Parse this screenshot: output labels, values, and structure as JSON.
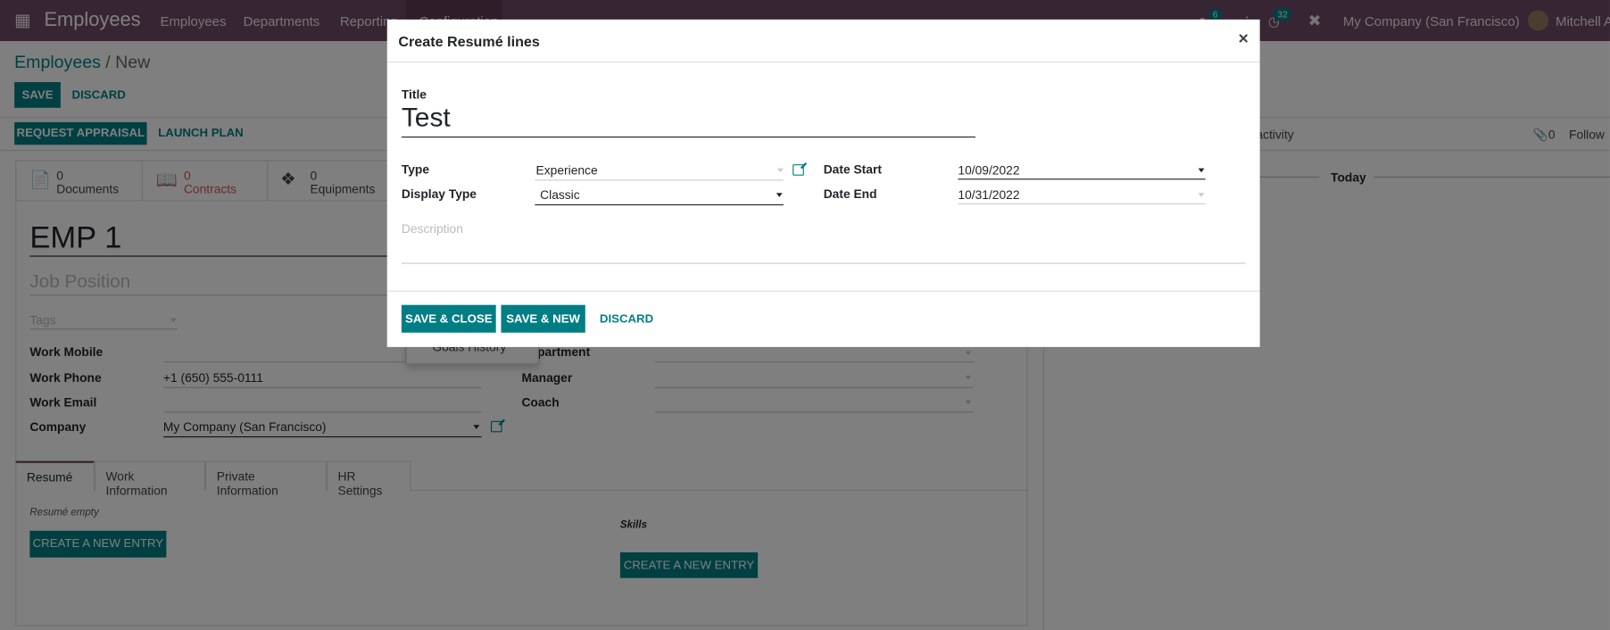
{
  "navbar": {
    "app": "Employees",
    "menu": [
      "Employees",
      "Departments",
      "Reporting",
      "Configuration"
    ],
    "chat_badge": "6",
    "activity_badge": "32",
    "company": "My Company (San Francisco)",
    "user": "Mitchell Admin",
    "color": "#714b67"
  },
  "breadcrumb": {
    "parent": "Employees",
    "sep": " / ",
    "current": "New"
  },
  "actions": {
    "save": "SAVE",
    "discard": "DISCARD",
    "request_appraisal": "REQUEST APPRAISAL",
    "launch_plan": "LAUNCH PLAN"
  },
  "chatter": {
    "schedule": "Schedule activity",
    "attachments": "0",
    "follow": "Follow",
    "today": "Today"
  },
  "stats": [
    {
      "count": "0",
      "label": "Documents"
    },
    {
      "count": "0",
      "label": "Contracts"
    },
    {
      "count": "0",
      "label": "Equipments"
    }
  ],
  "form": {
    "name": "EMP 1",
    "job_placeholder": "Job Position",
    "tags_placeholder": "Tags",
    "left": [
      {
        "label": "Work Mobile",
        "value": ""
      },
      {
        "label": "Work Phone",
        "value": "+1 (650) 555-0111"
      },
      {
        "label": "Work Email",
        "value": ""
      },
      {
        "label": "Company",
        "value": "My Company (San Francisco)"
      }
    ],
    "right": [
      {
        "label": "Department"
      },
      {
        "label": "Manager"
      },
      {
        "label": "Coach"
      }
    ],
    "dropdown_item": "Goals History",
    "tabs": [
      "Resumé",
      "Work Information",
      "Private Information",
      "HR Settings"
    ],
    "resume_empty": "Resumé empty",
    "skills": "Skills",
    "create_entry": "CREATE A NEW ENTRY"
  },
  "modal": {
    "title": "Create Resumé lines",
    "close": "×",
    "title_label": "Title",
    "title_value": "Test",
    "type_label": "Type",
    "type_value": "Experience",
    "display_type_label": "Display Type",
    "display_type_value": "Classic",
    "date_start_label": "Date Start",
    "date_start": "10/09/2022",
    "date_end_label": "Date End",
    "date_end": "10/31/2022",
    "description_placeholder": "Description",
    "save_close": "SAVE & CLOSE",
    "save_new": "SAVE & NEW",
    "discard": "DISCARD"
  },
  "colors": {
    "primary": "#017e84",
    "brand": "#714b67",
    "danger": "#d9534f"
  }
}
